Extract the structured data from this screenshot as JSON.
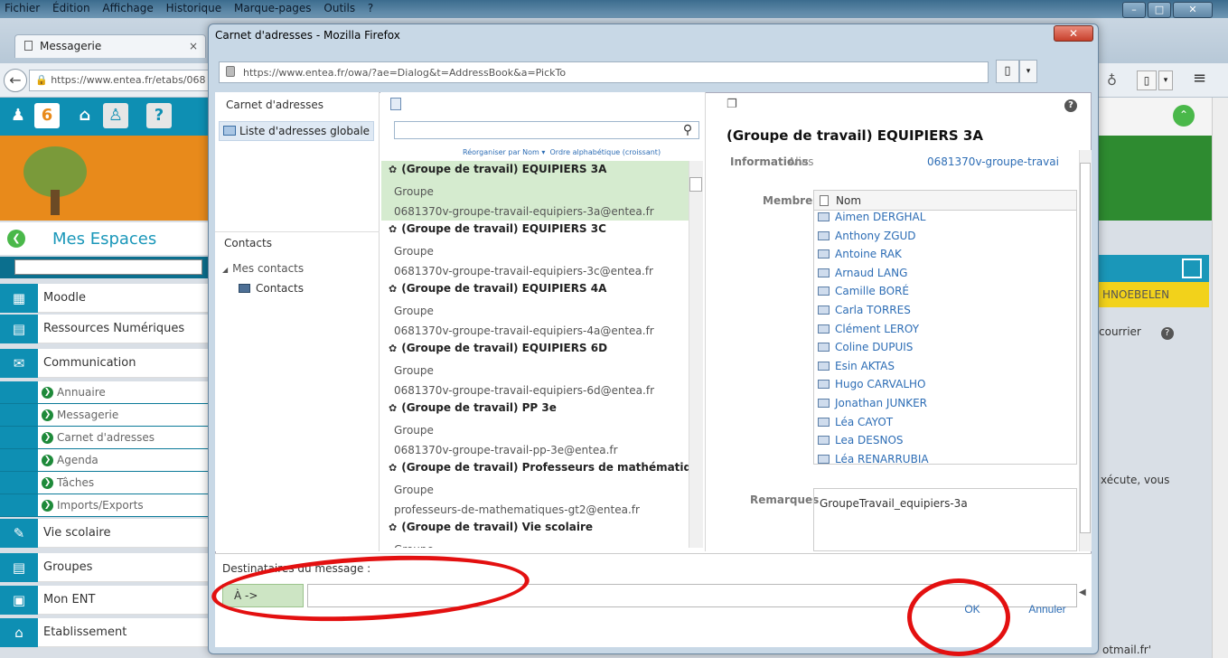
{
  "browser": {
    "menu": [
      "Fichier",
      "Édition",
      "Affichage",
      "Historique",
      "Marque-pages",
      "Outils",
      "?"
    ],
    "tab_label": "Messagerie",
    "url_bg": "https://www.entea.fr/etabs/068"
  },
  "app": {
    "badge": "6",
    "mes_espaces": "Mes Espaces",
    "nav": [
      {
        "label": "Moodle",
        "icon": "moodle-icon"
      },
      {
        "label": "Ressources Numériques",
        "icon": "book-icon"
      },
      {
        "label": "Communication",
        "icon": "mail-icon"
      }
    ],
    "sub": [
      "Annuaire",
      "Messagerie",
      "Carnet d'adresses",
      "Agenda",
      "Tâches",
      "Imports/Exports"
    ],
    "nav2": [
      {
        "label": "Vie scolaire",
        "icon": "edit-icon"
      },
      {
        "label": "Groupes",
        "icon": "book-icon"
      },
      {
        "label": "Mon ENT",
        "icon": "ent-icon"
      },
      {
        "label": "Etablissement",
        "icon": "home-icon"
      }
    ],
    "right_yellow": "HNOEBELEN",
    "right_courrier": "courrier",
    "right_execute": "xécute, vous",
    "right_mail": "otmail.fr'"
  },
  "dialog": {
    "title": "Carnet d'adresses - Mozilla Firefox",
    "url": "https://www.entea.fr/owa/?ae=Dialog&t=AddressBook&a=PickTo",
    "left": {
      "header": "Carnet d'adresses",
      "global_list": "Liste d'adresses globale",
      "contacts_header": "Contacts",
      "mes_contacts": "Mes contacts",
      "contacts_item": "Contacts"
    },
    "middle": {
      "search_placeholder": "",
      "sort_by": "Réorganiser par Nom",
      "order": "Ordre alphabétique (croissant)",
      "groups": [
        {
          "title": "(Groupe de travail) EQUIPIERS 3A",
          "type": "Groupe",
          "email": "0681370v-groupe-travail-equipiers-3a@entea.fr",
          "selected": true
        },
        {
          "title": "(Groupe de travail) EQUIPIERS 3C",
          "type": "Groupe",
          "email": "0681370v-groupe-travail-equipiers-3c@entea.fr"
        },
        {
          "title": "(Groupe de travail) EQUIPIERS 4A",
          "type": "Groupe",
          "email": "0681370v-groupe-travail-equipiers-4a@entea.fr"
        },
        {
          "title": "(Groupe de travail) EQUIPIERS 6D",
          "type": "Groupe",
          "email": "0681370v-groupe-travail-equipiers-6d@entea.fr"
        },
        {
          "title": "(Groupe de travail) PP 3e",
          "type": "Groupe",
          "email": "0681370v-groupe-travail-pp-3e@entea.fr"
        },
        {
          "title": "(Groupe de travail) Professeurs de mathématiques",
          "type": "Groupe",
          "email": "professeurs-de-mathematiques-gt2@entea.fr"
        },
        {
          "title": "(Groupe de travail) Vie scolaire",
          "type": "Groupe",
          "email": ""
        }
      ]
    },
    "detail": {
      "title": "(Groupe de travail) EQUIPIERS 3A",
      "info_label": "Informations",
      "alias_label": "Alias",
      "alias_value": "0681370v-groupe-travai",
      "members_label": "Membres",
      "name_col": "Nom",
      "members": [
        "Aimen DERGHAL",
        "Anthony ZGUD",
        "Antoine RAK",
        "Arnaud LANG",
        "Camille BORÉ",
        "Carla TORRES",
        "Clément LEROY",
        "Coline DUPUIS",
        "Esin AKTAS",
        "Hugo CARVALHO",
        "Jonathan JUNKER",
        "Léa CAYOT",
        "Lea DESNOS",
        "Léa RENARRUBIA"
      ],
      "remarks_label": "Remarques",
      "remarks_value": "GroupeTravail_equipiers-3a"
    },
    "bottom": {
      "recipients_label": "Destinataires du message :",
      "to_button": "À ->",
      "ok": "OK",
      "cancel": "Annuler"
    }
  },
  "colors": {
    "accent": "#0e8fb3",
    "selection": "#d5ebcf",
    "annotation": "#e31010",
    "link": "#2d6db5"
  }
}
